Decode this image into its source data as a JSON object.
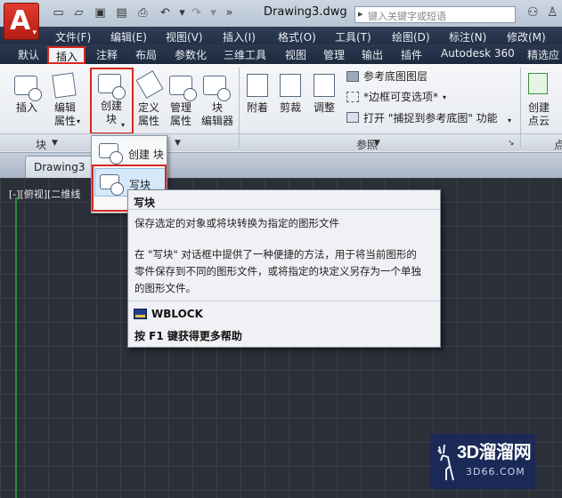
{
  "titlebar": {
    "doc_title": "Drawing3.dwg",
    "search_placeholder": "键入关键字或短语",
    "app_letter": "A"
  },
  "menu": [
    "文件(F)",
    "编辑(E)",
    "视图(V)",
    "插入(I)",
    "格式(O)",
    "工具(T)",
    "绘图(D)",
    "标注(N)",
    "修改(M)"
  ],
  "ribbon_tabs": [
    "默认",
    "插入",
    "注释",
    "布局",
    "参数化",
    "三维工具",
    "视图",
    "管理",
    "输出",
    "插件",
    "Autodesk 360",
    "精选应"
  ],
  "ribbon": {
    "insert": "插入",
    "edit_attr_1": "编辑",
    "edit_attr_2": "属性",
    "create_block_1": "创建",
    "create_block_2": "块",
    "define_attr_1": "定义",
    "define_attr_2": "属性",
    "manage_attr_1": "管理",
    "manage_attr_2": "属性",
    "block_editor_1": "块",
    "block_editor_2": "编辑器",
    "attach": "附着",
    "clip": "剪裁",
    "adjust": "调整",
    "ref_underlay_layer": "参考底图图层",
    "frame_variable": "*边框可变选项*",
    "snap_underlay": "打开 \"捕捉到参考底图\" 功能",
    "create_cloud_1": "创建",
    "create_cloud_2": "点云",
    "panel_block": "块",
    "panel_reference": "参照",
    "panel_point": "点"
  },
  "doc_tab": "Drawing3",
  "viewport_label": "[-][俯视][二维线",
  "dropdown": {
    "create_block": "创建 块",
    "write_block": "写块"
  },
  "tooltip": {
    "title": "写块",
    "desc": "保存选定的对象或将块转换为指定的图形文件",
    "detail_1": "在 \"写块\" 对话框中提供了一种便捷的方法，用于将当前图形的",
    "detail_2": "零件保存到不同的图形文件，或将指定的块定义另存为一个单独",
    "detail_3": "的图形文件。",
    "command": "WBLOCK",
    "help": "按 F1 键获得更多帮助"
  },
  "watermark": {
    "logo": "3D溜溜网",
    "sub": "3D66.COM"
  },
  "colors": {
    "highlight_red": "#d8261e",
    "drawing_bg": "#2b2f38",
    "menu_bg": "#223048"
  }
}
